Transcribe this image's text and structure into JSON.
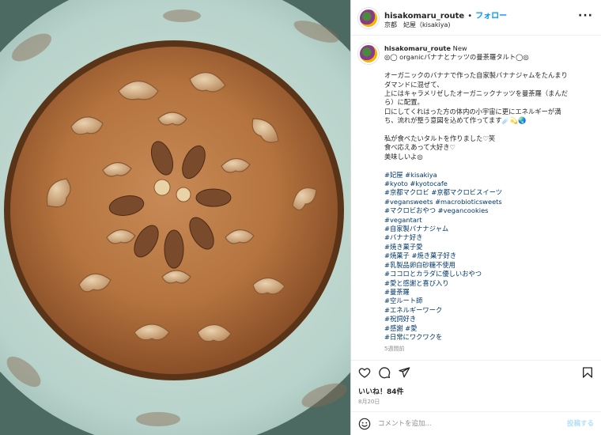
{
  "header": {
    "username": "hisakomaru_route",
    "dot": "•",
    "follow_label": "フォロー",
    "location": "京都　妃屋（kisakiya)",
    "more_icon": "more-horizontal-icon"
  },
  "caption": {
    "username": "hisakomaru_route",
    "badge": "New",
    "title": "◎◯ organicバナナとナッツの曼荼羅タルト◯◎",
    "lines": [
      "オーガニックのバナナで作った自家製バナナジャムをたんまり",
      "ダマンドに混ぜて、",
      "上にはキャラメリゼしたオーガニックナッツを曼荼羅（まんだ",
      "ら）に配置。",
      "口にしてくれはった方の体内の小宇宙に更にエネルギーが満",
      "ち、流れが整う意図を込めて作ってます☄️💫🌏",
      "",
      "私が食べたいタルトを作りました♡笑",
      "食べ応えあって大好き♡",
      "美味しいよ◎",
      ""
    ],
    "tag_lines": [
      "#妃屋 #kisakiya",
      "#kyoto #kyotocafe",
      "#京都マクロビ #京都マクロビスイーツ",
      "#vegansweets #macrobioticsweets",
      "#マクロビおやつ #vegancookies",
      "#vegantart",
      "#自家製バナナジャム",
      "#バナナ好き",
      "#焼き菓子愛",
      "#焼菓子 #焼き菓子好き",
      "#乳製品卵白砂糖不使用",
      "#ココロとカラダに優しいおやつ",
      "#愛と感謝と喜び入り",
      "#曼荼羅",
      "#空ルート師",
      "#エネルギーワーク",
      "#祝詞好き",
      "#感謝 #愛",
      "#日常にワクワクを"
    ],
    "time_ago": "5週間前"
  },
  "actions": {
    "like_icon": "heart-icon",
    "comment_icon": "comment-icon",
    "share_icon": "share-icon",
    "save_icon": "bookmark-icon"
  },
  "likes_text": "いいね！84件",
  "date_text": "8月20日",
  "comment": {
    "emoji_icon": "emoji-icon",
    "placeholder": "コメントを追加...",
    "post_label": "投稿する"
  },
  "colors": {
    "accent": "#0095f6",
    "link": "#00376b",
    "muted": "#8e8e8e"
  }
}
